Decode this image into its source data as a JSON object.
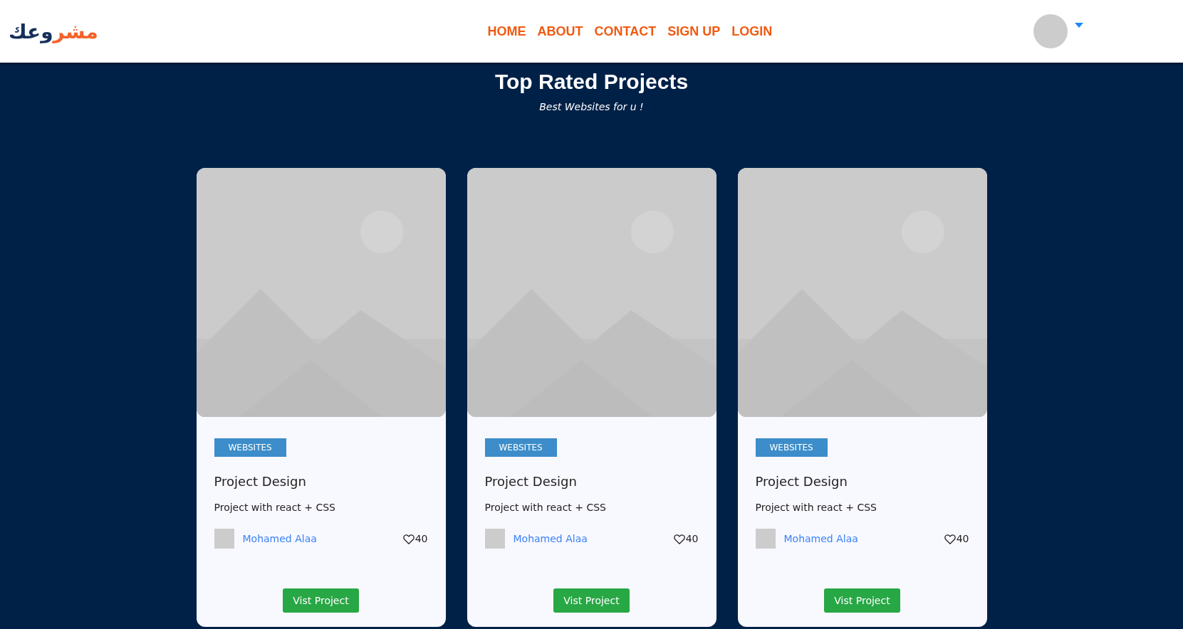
{
  "navbar": {
    "logo": {
      "accent": "مشر",
      "rest": "وعك"
    },
    "links": [
      {
        "label": "HOME"
      },
      {
        "label": "ABOUT"
      },
      {
        "label": "CONTACT"
      },
      {
        "label": "SIGN UP"
      },
      {
        "label": "LOGIN"
      }
    ]
  },
  "hero": {
    "title": "Top Rated Projects",
    "subtitle": "Best Websites for u !"
  },
  "cards": [
    {
      "category": "WEBSITES",
      "title": "Project Design",
      "description": "Project with react + CSS",
      "author": "Mohamed Alaa",
      "likes": "40",
      "button": "Vist Project"
    },
    {
      "category": "WEBSITES",
      "title": "Project Design",
      "description": "Project with react + CSS",
      "author": "Mohamed Alaa",
      "likes": "40",
      "button": "Vist Project"
    },
    {
      "category": "WEBSITES",
      "title": "Project Design",
      "description": "Project with react + CSS",
      "author": "Mohamed Alaa",
      "likes": "40",
      "button": "Vist Project"
    }
  ]
}
